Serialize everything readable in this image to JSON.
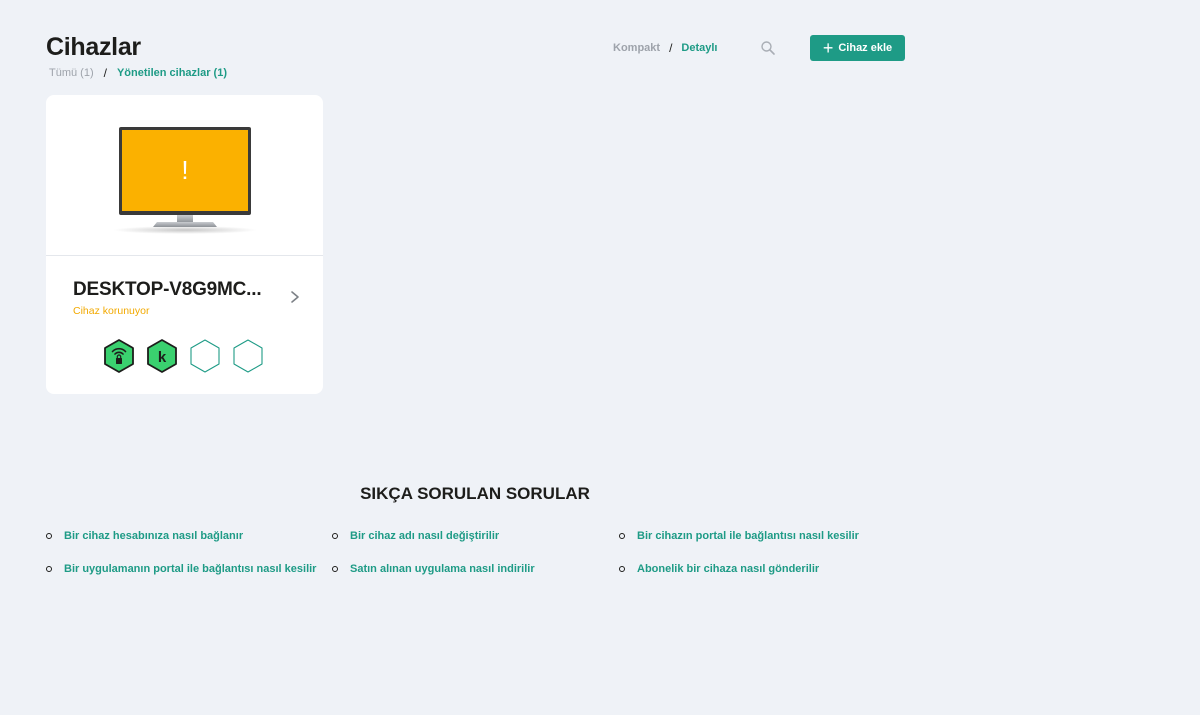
{
  "header": {
    "title": "Cihazlar",
    "filter_all": "Tümü (1)",
    "filter_separator": "/",
    "filter_managed": "Yönetilen cihazlar (1)",
    "view_compact": "Kompakt",
    "view_separator": "/",
    "view_detailed": "Detaylı",
    "search_icon": "search-icon",
    "add_button_label": "Cihaz ekle",
    "add_button_icon": "plus-icon"
  },
  "device": {
    "name": "DESKTOP-V8G9MC...",
    "status": "Cihaz korunuyor",
    "alert_glyph": "!",
    "apps": [
      "wifi-lock-icon",
      "kaspersky-k-icon",
      "empty-slot-icon",
      "empty-slot-icon"
    ],
    "app_letter": "k"
  },
  "faq": {
    "title": "SIKÇA SORULAN SORULAR",
    "items": [
      "Bir cihaz hesabınıza nasıl bağlanır",
      "Bir cihaz adı nasıl değiştirilir",
      "Bir cihazın portal ile bağlantısı nasıl kesilir",
      "Bir uygulamanın portal ile bağlantısı nasıl kesilir",
      "Satın alınan uygulama nasıl indirilir",
      "Abonelik bir cihaza nasıl gönderilir"
    ]
  },
  "colors": {
    "accent": "#1e9b86",
    "warning": "#f2a900",
    "screen": "#fbb100",
    "background": "#eff2f7",
    "hex_green": "#3ad16f"
  }
}
